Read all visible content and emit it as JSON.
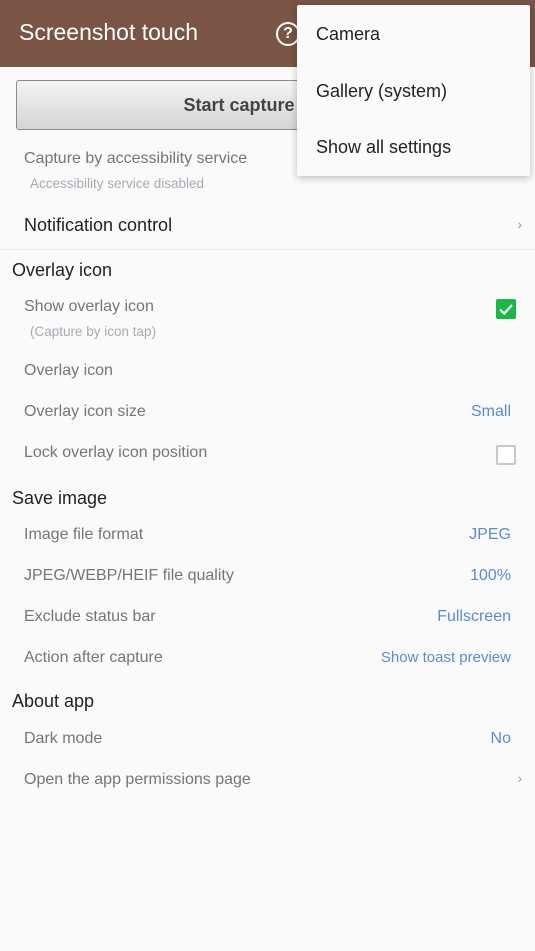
{
  "appbar": {
    "title": "Screenshot touch",
    "help_icon": "help-circle-icon"
  },
  "capture_button": {
    "label": "Start capture monit"
  },
  "accessibility": {
    "label": "Capture by accessibility service",
    "summary": "Accessibility service disabled"
  },
  "notification": {
    "label": "Notification control",
    "icon": "chevron-right-icon"
  },
  "sections": {
    "overlay": {
      "header": "Overlay icon",
      "show_overlay": {
        "label": "Show overlay icon",
        "summary": "(Capture by icon tap)",
        "checked": true
      },
      "overlay_icon": {
        "label": "Overlay icon"
      },
      "overlay_size": {
        "label": "Overlay icon size",
        "value": "Small"
      },
      "lock_position": {
        "label": "Lock overlay icon position",
        "checked": false
      }
    },
    "save": {
      "header": "Save image",
      "format": {
        "label": "Image file format",
        "value": "JPEG"
      },
      "quality": {
        "label": "JPEG/WEBP/HEIF file quality",
        "value": "100%"
      },
      "status_bar": {
        "label": "Exclude status bar",
        "value": "Fullscreen"
      },
      "action": {
        "label": "Action after capture",
        "value": "Show toast preview"
      }
    },
    "about": {
      "header": "About app",
      "dark_mode": {
        "label": "Dark mode",
        "value": "No"
      },
      "permissions": {
        "label": "Open the app permissions page"
      }
    }
  },
  "menu": {
    "items": [
      "Camera",
      "Gallery (system)",
      "Show all settings"
    ]
  },
  "colors": {
    "appbar": "#7a5445",
    "accent_value": "#5a8ccb",
    "checkbox_on": "#1db745"
  }
}
